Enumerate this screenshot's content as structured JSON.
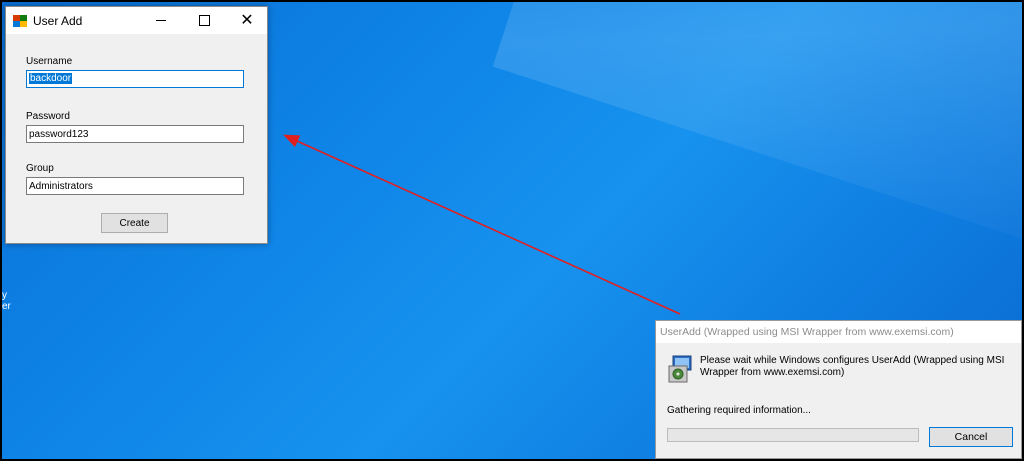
{
  "desktop": {
    "edge_text": "y\ner"
  },
  "user_add_window": {
    "title": "User Add",
    "fields": {
      "username": {
        "label": "Username",
        "value": "backdoor"
      },
      "password": {
        "label": "Password",
        "value": "password123"
      },
      "group": {
        "label": "Group",
        "value": "Administrators"
      }
    },
    "create_label": "Create",
    "close_glyph": "✕"
  },
  "msi_dialog": {
    "title": "UserAdd (Wrapped using MSI Wrapper from www.exemsi.com)",
    "message": "Please wait while Windows configures UserAdd (Wrapped using MSI Wrapper from www.exemsi.com)",
    "status": "Gathering required information...",
    "progress": 0,
    "cancel_label": "Cancel"
  },
  "annotation": {
    "arrow_color": "#e02020"
  }
}
